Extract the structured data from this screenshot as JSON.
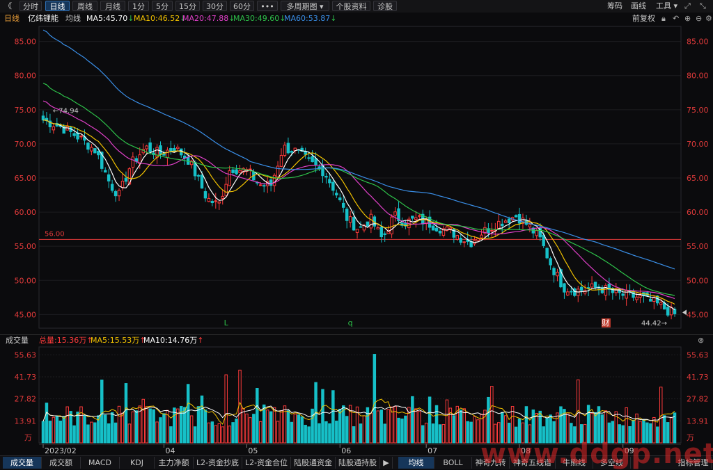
{
  "toolbar": {
    "back_glyph": "《",
    "periods": [
      "分时",
      "日线",
      "周线",
      "月线",
      "1分",
      "5分",
      "15分",
      "30分",
      "60分"
    ],
    "active_period": "日线",
    "more": "•••",
    "multi_period": "多周期图",
    "stock_info": "个股资料",
    "diagnosis": "诊股",
    "right_items": [
      "筹码",
      "画线",
      "工具"
    ]
  },
  "info": {
    "period": "日线",
    "stock_name": "亿纬锂能",
    "ma_label": "均线",
    "ma5": "MA5:45.70",
    "ma10": "MA10:46.52",
    "ma20": "MA20:47.88",
    "ma30": "MA30:49.60",
    "ma60": "MA60:53.87",
    "adjust": "前复权"
  },
  "colors": {
    "up": "#ff3b3b",
    "down": "#16c0c8",
    "ma5": "#ffffff",
    "ma10": "#f2c200",
    "ma20": "#e040c8",
    "ma30": "#2ec24a",
    "ma60": "#3a8fe8",
    "axis": "#e03a3a"
  },
  "price_axis_labels": [
    "85.00",
    "80.00",
    "75.00",
    "70.00",
    "65.00",
    "60.00",
    "55.00",
    "50.00",
    "45.00"
  ],
  "hline_label": "56.00",
  "high_mark": "74.94",
  "low_mark": "44.42",
  "event_markers": [
    "L",
    "q",
    "财"
  ],
  "volume_info": {
    "title": "成交量",
    "total": "总量:15.36万",
    "ma5": "MA5:15.53万",
    "ma10": "MA10:14.76万"
  },
  "volume_axis_labels": [
    "55.63",
    "41.73",
    "27.82",
    "13.91"
  ],
  "volume_unit": "万",
  "date_labels": [
    "2023/02",
    "04",
    "05",
    "06",
    "07",
    "08",
    "09"
  ],
  "bottom_left_tabs": [
    "成交量",
    "成交额",
    "MACD",
    "KDJ",
    "主力净额",
    "L2-资金抄底",
    "L2-资金合位",
    "陆股通资金",
    "陆股通持股"
  ],
  "bottom_right_tabs": [
    "均线",
    "BOLL",
    "神奇九转",
    "神奇五线谱",
    "牛熊线",
    "多空线"
  ],
  "indicator_manage": "指标管理",
  "watermark": "www.ddgp.net",
  "chart_data": {
    "type": "candlestick",
    "ylim": [
      43,
      87
    ],
    "volume_ylim": [
      0,
      58
    ],
    "hline": 56.0,
    "months": [
      {
        "label": "2023/02",
        "index": 0
      },
      {
        "label": "04",
        "index": 35
      },
      {
        "label": "05",
        "index": 59
      },
      {
        "label": "06",
        "index": 86
      },
      {
        "label": "07",
        "index": 111
      },
      {
        "label": "08",
        "index": 138
      },
      {
        "label": "09",
        "index": 168
      }
    ]
  }
}
